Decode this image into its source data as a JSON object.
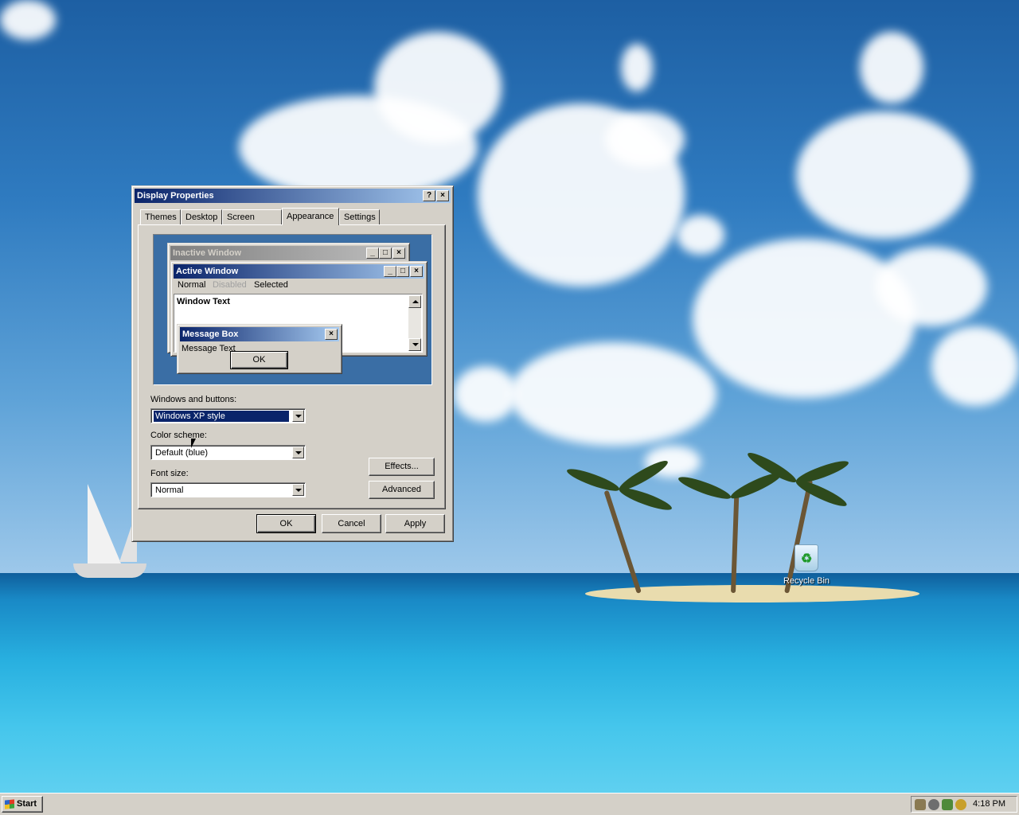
{
  "desktop": {
    "icons": [
      {
        "label": "Recycle Bin",
        "icon": "recycle-bin-icon"
      }
    ]
  },
  "dialog": {
    "title": "Display Properties",
    "help_label": "?",
    "close_label": "×",
    "tabs": [
      {
        "label": "Themes"
      },
      {
        "label": "Desktop"
      },
      {
        "label": "Screen Saver"
      },
      {
        "label": "Appearance",
        "active": true
      },
      {
        "label": "Settings"
      }
    ],
    "preview": {
      "inactive_title": "Inactive Window",
      "active_title": "Active Window",
      "menu": {
        "normal": "Normal",
        "disabled": "Disabled",
        "selected": "Selected"
      },
      "window_text": "Window Text",
      "message_box_title": "Message Box",
      "message_text": "Message Text",
      "ok_label": "OK"
    },
    "windows_buttons_label": "Windows and buttons:",
    "windows_buttons_value": "Windows XP style",
    "color_scheme_label": "Color scheme:",
    "color_scheme_value": "Default (blue)",
    "font_size_label": "Font size:",
    "font_size_value": "Normal",
    "effects_label": "Effects...",
    "advanced_label": "Advanced",
    "ok_label": "OK",
    "cancel_label": "Cancel",
    "apply_label": "Apply"
  },
  "taskbar": {
    "start_label": "Start",
    "clock": "4:18 PM",
    "tray_icons": [
      "network-icon",
      "volume-icon",
      "security-icon",
      "update-icon"
    ]
  },
  "colors": {
    "active_title_start": "#0a246a",
    "active_title_end": "#a6caf0",
    "face": "#d4d0c8",
    "preview_desktop": "#3a6ea5"
  }
}
